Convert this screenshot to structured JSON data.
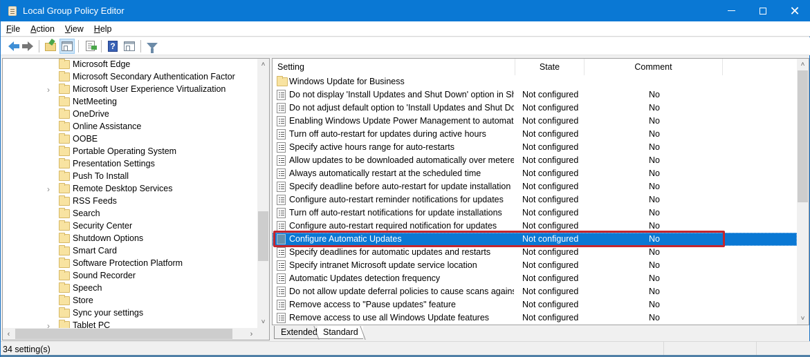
{
  "window": {
    "title": "Local Group Policy Editor",
    "controls": {
      "minimize": "minimize",
      "maximize": "maximize",
      "close": "close"
    }
  },
  "menu": [
    {
      "label": "File",
      "access_key": "F",
      "rest": "ile"
    },
    {
      "label": "Action",
      "access_key": "A",
      "rest": "ction"
    },
    {
      "label": "View",
      "access_key": "V",
      "rest": "iew"
    },
    {
      "label": "Help",
      "access_key": "H",
      "rest": "elp"
    }
  ],
  "toolbar": [
    {
      "name": "back",
      "icon": "arrow-left-icon"
    },
    {
      "name": "forward",
      "icon": "arrow-right-icon"
    },
    {
      "name": "up-one-level",
      "icon": "folder-up-icon"
    },
    {
      "name": "show-hide-console-tree",
      "icon": "pane-icon",
      "active": true
    },
    {
      "name": "export-list",
      "icon": "export-list-icon"
    },
    {
      "name": "help",
      "icon": "help-icon"
    },
    {
      "name": "show-hide-action-pane",
      "icon": "pane-icon"
    },
    {
      "name": "filter",
      "icon": "filter-icon"
    }
  ],
  "tree": {
    "items": [
      {
        "label": "Microsoft Edge",
        "expandable": false
      },
      {
        "label": "Microsoft Secondary Authentication Factor",
        "expandable": false
      },
      {
        "label": "Microsoft User Experience Virtualization",
        "expandable": true
      },
      {
        "label": "NetMeeting",
        "expandable": false
      },
      {
        "label": "OneDrive",
        "expandable": false
      },
      {
        "label": "Online Assistance",
        "expandable": false
      },
      {
        "label": "OOBE",
        "expandable": false
      },
      {
        "label": "Portable Operating System",
        "expandable": false
      },
      {
        "label": "Presentation Settings",
        "expandable": false
      },
      {
        "label": "Push To Install",
        "expandable": false
      },
      {
        "label": "Remote Desktop Services",
        "expandable": true
      },
      {
        "label": "RSS Feeds",
        "expandable": false
      },
      {
        "label": "Search",
        "expandable": false
      },
      {
        "label": "Security Center",
        "expandable": false
      },
      {
        "label": "Shutdown Options",
        "expandable": false
      },
      {
        "label": "Smart Card",
        "expandable": false
      },
      {
        "label": "Software Protection Platform",
        "expandable": false
      },
      {
        "label": "Sound Recorder",
        "expandable": false
      },
      {
        "label": "Speech",
        "expandable": false
      },
      {
        "label": "Store",
        "expandable": false
      },
      {
        "label": "Sync your settings",
        "expandable": false
      },
      {
        "label": "Tablet PC",
        "expandable": true
      }
    ],
    "expander_glyph": "›"
  },
  "list": {
    "columns": {
      "setting": "Setting",
      "state": "State",
      "comment": "Comment"
    },
    "rows": [
      {
        "type": "folder",
        "setting": "Windows Update for Business",
        "state": "",
        "comment": ""
      },
      {
        "type": "policy",
        "setting": "Do not display 'Install Updates and Shut Down' option in Sh...",
        "state": "Not configured",
        "comment": "No"
      },
      {
        "type": "policy",
        "setting": "Do not adjust default option to 'Install Updates and Shut Do...",
        "state": "Not configured",
        "comment": "No"
      },
      {
        "type": "policy",
        "setting": "Enabling Windows Update Power Management to automati...",
        "state": "Not configured",
        "comment": "No"
      },
      {
        "type": "policy",
        "setting": "Turn off auto-restart for updates during active hours",
        "state": "Not configured",
        "comment": "No"
      },
      {
        "type": "policy",
        "setting": "Specify active hours range for auto-restarts",
        "state": "Not configured",
        "comment": "No"
      },
      {
        "type": "policy",
        "setting": "Allow updates to be downloaded automatically over metere...",
        "state": "Not configured",
        "comment": "No"
      },
      {
        "type": "policy",
        "setting": "Always automatically restart at the scheduled time",
        "state": "Not configured",
        "comment": "No"
      },
      {
        "type": "policy",
        "setting": "Specify deadline before auto-restart for update installation",
        "state": "Not configured",
        "comment": "No"
      },
      {
        "type": "policy",
        "setting": "Configure auto-restart reminder notifications for updates",
        "state": "Not configured",
        "comment": "No"
      },
      {
        "type": "policy",
        "setting": "Turn off auto-restart notifications for update installations",
        "state": "Not configured",
        "comment": "No"
      },
      {
        "type": "policy",
        "setting": "Configure auto-restart required notification for updates",
        "state": "Not configured",
        "comment": "No"
      },
      {
        "type": "policy",
        "setting": "Configure Automatic Updates",
        "state": "Not configured",
        "comment": "No",
        "selected": true
      },
      {
        "type": "policy",
        "setting": "Specify deadlines for automatic updates and restarts",
        "state": "Not configured",
        "comment": "No"
      },
      {
        "type": "policy",
        "setting": "Specify intranet Microsoft update service location",
        "state": "Not configured",
        "comment": "No"
      },
      {
        "type": "policy",
        "setting": "Automatic Updates detection frequency",
        "state": "Not configured",
        "comment": "No"
      },
      {
        "type": "policy",
        "setting": "Do not allow update deferral policies to cause scans against ...",
        "state": "Not configured",
        "comment": "No"
      },
      {
        "type": "policy",
        "setting": "Remove access to \"Pause updates\" feature",
        "state": "Not configured",
        "comment": "No"
      },
      {
        "type": "policy",
        "setting": "Remove access to use all Windows Update features",
        "state": "Not configured",
        "comment": "No"
      }
    ],
    "highlight_color": "#c4262e",
    "selection_color": "#0a78d4"
  },
  "tabs": [
    {
      "label": "Extended",
      "active": false
    },
    {
      "label": "Standard",
      "active": true
    }
  ],
  "status": {
    "text": "34 setting(s)"
  },
  "scroll": {
    "tree_vertical_position_fraction": 0.72,
    "list_vertical_position_fraction": 0.0
  },
  "arrows": {
    "up": "˄",
    "down": "˅",
    "left": "‹",
    "right": "›"
  },
  "colors": {
    "titlebar": "#0a78d4",
    "accent": "#0a78d4"
  }
}
